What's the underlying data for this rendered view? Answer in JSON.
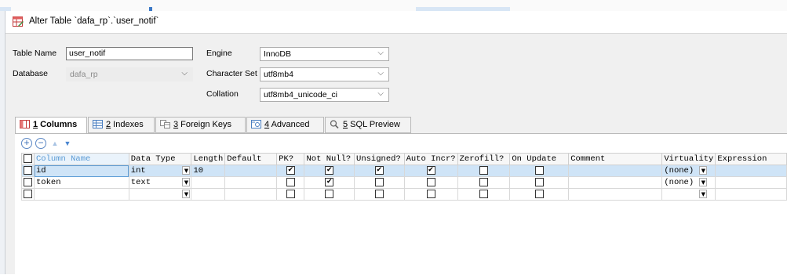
{
  "window": {
    "title": "Alter Table `dafa_rp`.`user_notif`"
  },
  "form": {
    "table_name_label": "Table Name",
    "table_name_value": "user_notif",
    "database_label": "Database",
    "database_value": "dafa_rp",
    "engine_label": "Engine",
    "engine_value": "InnoDB",
    "charset_label": "Character Set",
    "charset_value": "utf8mb4",
    "collation_label": "Collation",
    "collation_value": "utf8mb4_unicode_ci"
  },
  "tabs": [
    {
      "num": "1",
      "label": " Columns",
      "icon": "columns-icon"
    },
    {
      "num": "2",
      "label": " Indexes",
      "icon": "indexes-icon"
    },
    {
      "num": "3",
      "label": " Foreign Keys",
      "icon": "foreign-keys-icon"
    },
    {
      "num": "4",
      "label": " Advanced",
      "icon": "advanced-icon"
    },
    {
      "num": "5",
      "label": " SQL Preview",
      "icon": "sql-preview-icon"
    }
  ],
  "grid": {
    "headers": [
      "Column Name",
      "Data Type",
      "Length",
      "Default",
      "PK?",
      "Not Null?",
      "Unsigned?",
      "Auto Incr?",
      "Zerofill?",
      "On Update",
      "Comment",
      "Virtuality",
      "Expression"
    ],
    "rows": [
      {
        "name": "id",
        "type": "int",
        "length": "10",
        "default": "",
        "pk": true,
        "notnull": true,
        "unsigned": true,
        "autoinc": true,
        "zerofill": false,
        "onupdate": "",
        "comment": "",
        "virtuality": "(none)",
        "expression": ""
      },
      {
        "name": "token",
        "type": "text",
        "length": "",
        "default": "",
        "pk": false,
        "notnull": true,
        "unsigned": false,
        "autoinc": false,
        "zerofill": false,
        "onupdate": "",
        "comment": "",
        "virtuality": "(none)",
        "expression": ""
      },
      {
        "name": "",
        "type": "",
        "length": "",
        "default": "",
        "pk": false,
        "notnull": false,
        "unsigned": false,
        "autoinc": false,
        "zerofill": false,
        "onupdate": "",
        "comment": "",
        "virtuality": "",
        "expression": ""
      }
    ]
  },
  "colors": {
    "selected_row": "#cfe4f7",
    "accent": "#5b9bd5"
  }
}
